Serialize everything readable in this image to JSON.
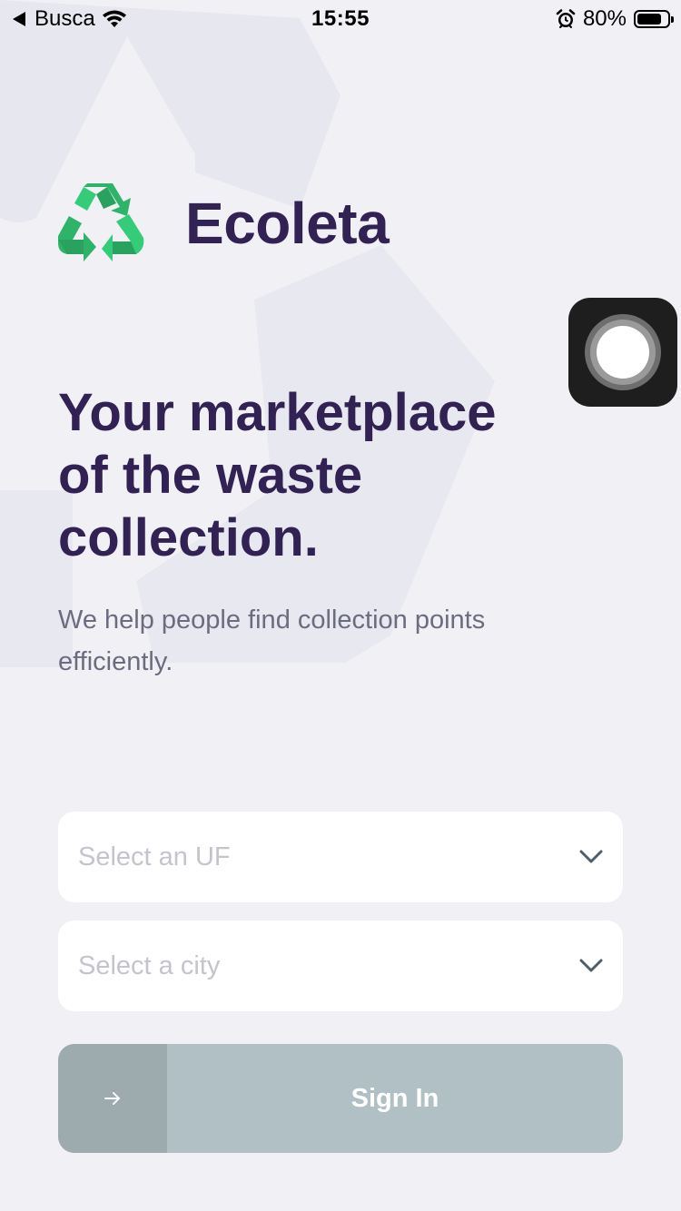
{
  "status_bar": {
    "carrier": "Busca",
    "time": "15:55",
    "battery_percent": "80%",
    "battery_level": 0.8
  },
  "logo": {
    "name": "Ecoleta",
    "icon": "recycle-icon"
  },
  "hero": {
    "headline_lines": [
      "Your marketplace",
      "of the waste",
      "collection."
    ],
    "subtitle_lines": [
      "We help people find collection points",
      "efficiently."
    ]
  },
  "form": {
    "uf_select": {
      "placeholder": "Select an UF",
      "icon": "chevron-down-icon"
    },
    "city_select": {
      "placeholder": "Select a city",
      "icon": "chevron-down-icon"
    },
    "sign_in": {
      "label": "Sign In",
      "icon": "arrow-right-icon"
    }
  },
  "assistive_touch": {
    "icon": "assistive-touch-icon"
  },
  "colors": {
    "background": "#F0F0F5",
    "title": "#322153",
    "text": "#6C6C80",
    "placeholder": "#C4C4CC",
    "button": "#B1C0C4",
    "button_icon_box": "#9DAAAE",
    "brand_green": "#34CB79"
  }
}
